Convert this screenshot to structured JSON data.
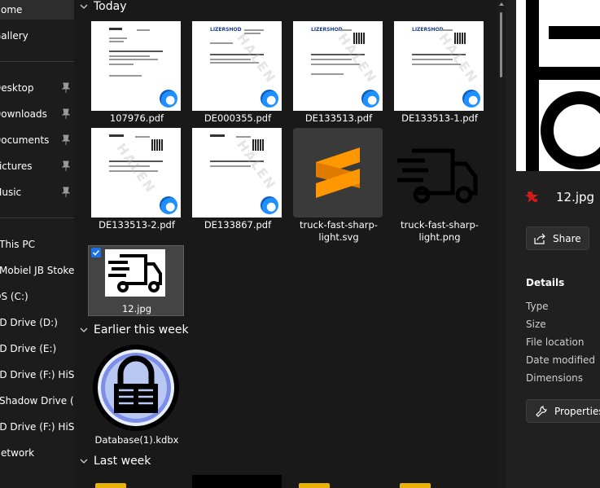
{
  "sidebar": {
    "items": [
      {
        "label": "Home",
        "pinned": false
      },
      {
        "label": "Gallery",
        "pinned": false
      },
      {
        "label": "Desktop",
        "pinned": true
      },
      {
        "label": "Downloads",
        "pinned": true
      },
      {
        "label": "Documents",
        "pinned": true
      },
      {
        "label": "Pictures",
        "pinned": true
      },
      {
        "label": "Music",
        "pinned": true
      },
      {
        "label": "This PC",
        "pinned": false
      },
      {
        "label": "Mobiel JB Stoker",
        "pinned": false
      },
      {
        "label": "OS (C:)",
        "pinned": false
      },
      {
        "label": "CD Drive (D:)",
        "pinned": false
      },
      {
        "label": "CD Drive (E:)",
        "pinned": false
      },
      {
        "label": "CD Drive (F:) HiSuite",
        "pinned": false
      },
      {
        "label": "Shadow Drive (Z:)",
        "pinned": false
      },
      {
        "label": "CD Drive (F:) HiSuite",
        "pinned": false
      },
      {
        "label": "Network",
        "pinned": false
      }
    ]
  },
  "groups": {
    "today": {
      "label": "Today"
    },
    "earlier": {
      "label": "Earlier this week"
    },
    "last_week": {
      "label": "Last week"
    }
  },
  "files": {
    "f1": {
      "name": "107976.pdf",
      "type": "pdf"
    },
    "f2": {
      "name": "DE000355.pdf",
      "type": "pdf",
      "logo": "LIZERSHOD"
    },
    "f3": {
      "name": "DE133513.pdf",
      "type": "pdf",
      "logo": "LIZERSHOD"
    },
    "f4": {
      "name": "DE133513-1.pdf",
      "type": "pdf",
      "logo": "LIZERSHOD"
    },
    "f5": {
      "name": "DE133513-2.pdf",
      "type": "pdf"
    },
    "f6": {
      "name": "DE133867.pdf",
      "type": "pdf"
    },
    "f7": {
      "name": "truck-fast-sharp-light.svg",
      "type": "svg"
    },
    "f8": {
      "name": "truck-fast-sharp-light.png",
      "type": "png"
    },
    "f9": {
      "name": "12.jpg",
      "type": "jpg",
      "selected": true
    },
    "f10": {
      "name": "Database(1).kdbx",
      "type": "kdbx"
    }
  },
  "details": {
    "file_title": "12.jpg",
    "share_label": "Share",
    "heading": "Details",
    "properties": [
      "Type",
      "Size",
      "File location",
      "Date modified",
      "Dimensions"
    ],
    "properties_button": "Properties"
  },
  "colors": {
    "background": "#191919",
    "sidebar": "#1c1c1c",
    "selection": "#444444",
    "accent": "#1e90ff",
    "sublime_orange": "#ff9800"
  }
}
